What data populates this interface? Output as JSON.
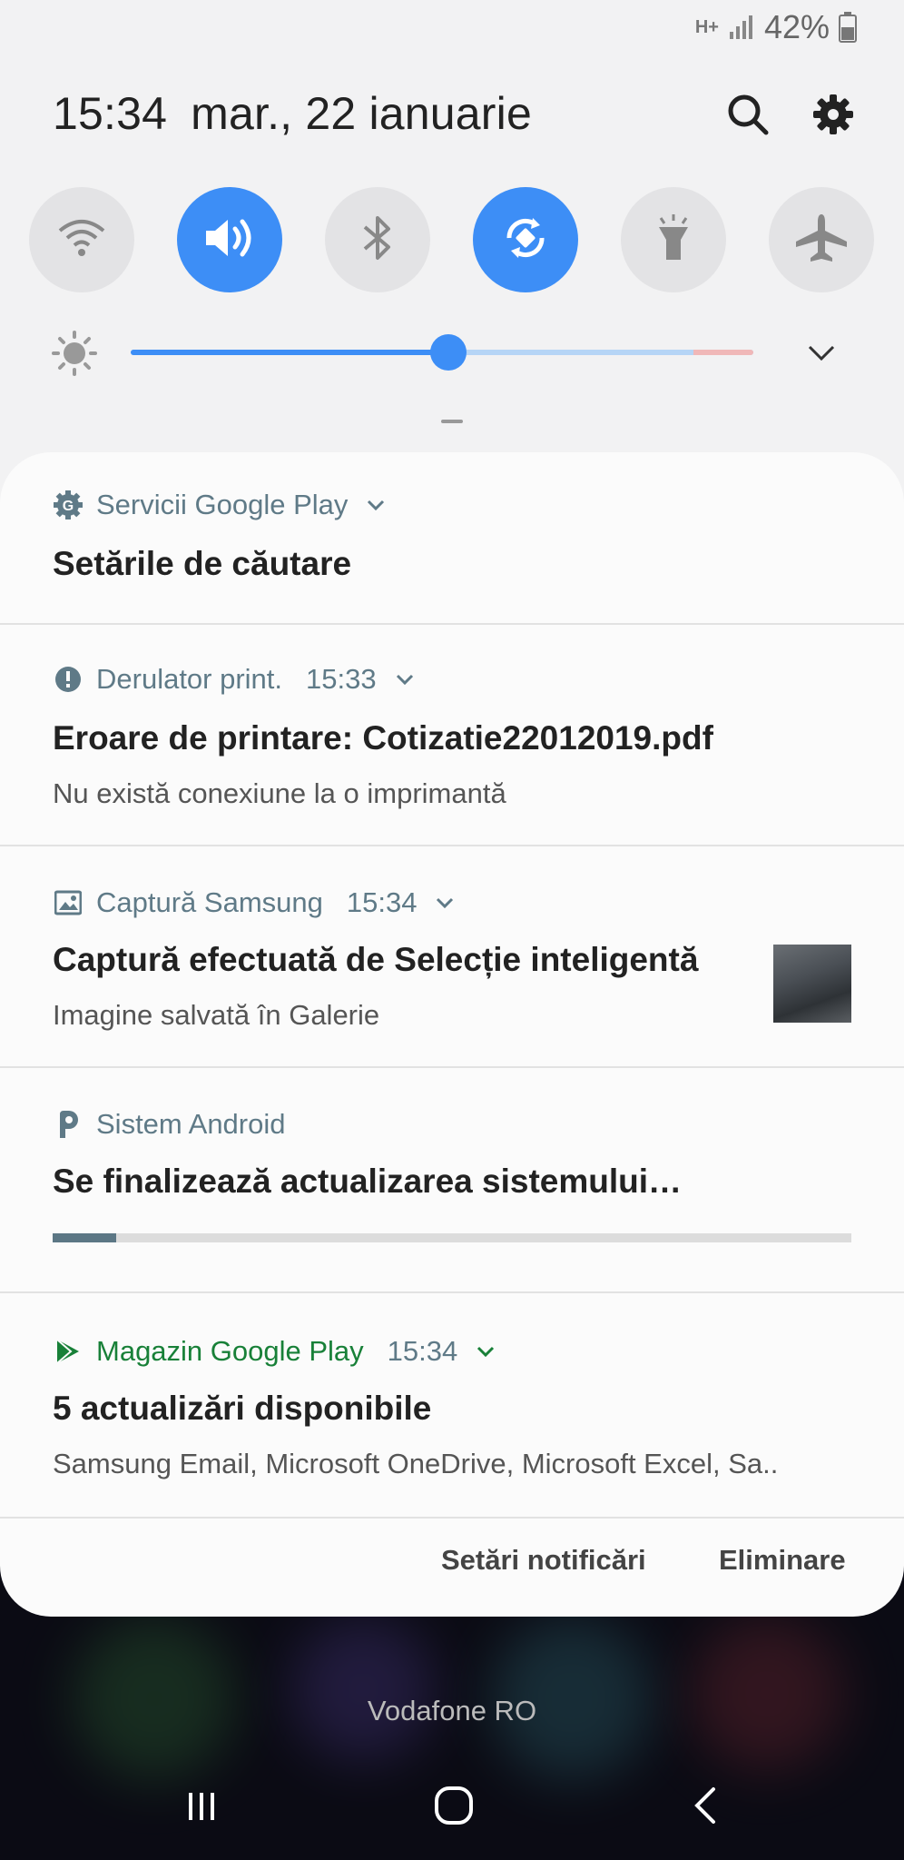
{
  "status": {
    "network_type": "H+",
    "battery_percent": "42%"
  },
  "header": {
    "time": "15:34",
    "date": "mar., 22 ianuarie"
  },
  "toggles": [
    {
      "name": "wifi",
      "icon": "wifi-icon",
      "on": false
    },
    {
      "name": "sound",
      "icon": "volume-icon",
      "on": true
    },
    {
      "name": "bluetooth",
      "icon": "bluetooth-icon",
      "on": false
    },
    {
      "name": "auto-rotate",
      "icon": "rotate-icon",
      "on": true
    },
    {
      "name": "flashlight",
      "icon": "flashlight-icon",
      "on": false
    },
    {
      "name": "airplane",
      "icon": "airplane-icon",
      "on": false
    }
  ],
  "brightness": {
    "level": 0.51
  },
  "colors": {
    "accent": "#3d8ef6",
    "google_play_green": "#188038",
    "muted_text": "#5f7a87"
  },
  "notifications": [
    {
      "app": "Servicii Google Play",
      "time": "",
      "title": "Setările de căutare",
      "body": ""
    },
    {
      "app": "Derulator print.",
      "time": "15:33",
      "title": "Eroare de printare: Cotizatie22012019.pdf",
      "body": "Nu există conexiune la o imprimantă"
    },
    {
      "app": "Captură Samsung",
      "time": "15:34",
      "title": "Captură efectuată de Selecție inteligentă",
      "body": "Imagine salvată în Galerie"
    },
    {
      "app": "Sistem Android",
      "time": "",
      "title": "Se finalizează actualizarea sistemului…",
      "body": "",
      "progress": 0.08
    },
    {
      "app": "Magazin Google Play",
      "time": "15:34",
      "title": "5 actualizări disponibile",
      "body": "Samsung Email, Microsoft OneDrive, Microsoft Excel, Sa.."
    }
  ],
  "actions": {
    "settings_label": "Setări notificări",
    "clear_label": "Eliminare"
  },
  "carrier": "Vodafone RO"
}
